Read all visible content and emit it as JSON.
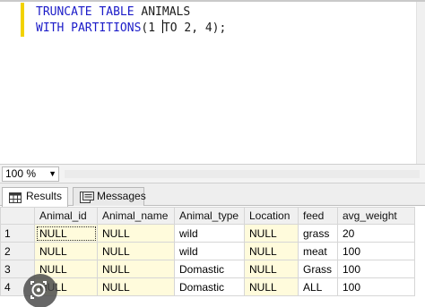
{
  "editor": {
    "line1": {
      "kw1": "TRUNCATE TABLE",
      "rest": " ANIMALS"
    },
    "line2": {
      "kw1": "WITH PARTITIONS",
      "pre_caret": "(1 ",
      "post_caret": "TO 2, 4);"
    }
  },
  "zoom": {
    "value": "100 %"
  },
  "tabs": {
    "results": "Results",
    "messages": "Messages"
  },
  "grid": {
    "columns": [
      "Animal_id",
      "Animal_name",
      "Animal_type",
      "Location",
      "feed",
      "avg_weight"
    ],
    "rows": [
      {
        "num": "1",
        "cells": [
          "NULL",
          "NULL",
          "wild",
          "NULL",
          "grass",
          "20"
        ]
      },
      {
        "num": "2",
        "cells": [
          "NULL",
          "NULL",
          "wild",
          "NULL",
          "meat",
          "100"
        ]
      },
      {
        "num": "3",
        "cells": [
          "NULL",
          "NULL",
          "Domastic",
          "NULL",
          "Grass",
          "100"
        ]
      },
      {
        "num": "4",
        "cells": [
          "NULL",
          "NULL",
          "Domastic",
          "NULL",
          "ALL",
          "100"
        ]
      }
    ]
  },
  "colors": {
    "keyword": "#1b1bc8",
    "null_bg": "#fffbdc",
    "gutter_marker": "#f2d200"
  },
  "icons": {
    "results_tab": "grid-icon",
    "messages_tab": "messages-icon",
    "overlay": "lens-icon"
  }
}
